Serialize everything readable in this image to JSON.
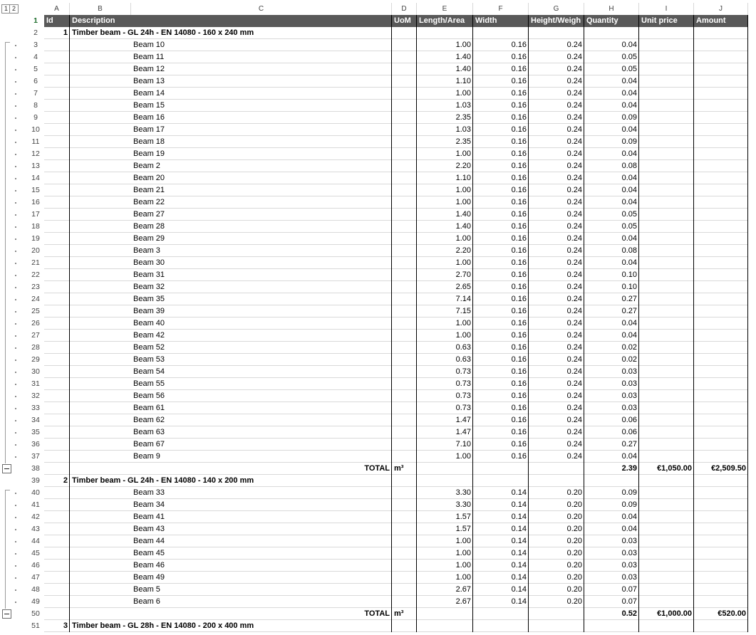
{
  "outline_levels": [
    "1",
    "2"
  ],
  "columns": [
    "A",
    "B",
    "C",
    "D",
    "E",
    "F",
    "G",
    "H",
    "I",
    "J"
  ],
  "header_row": {
    "row": "1",
    "cells": [
      "Id",
      "Description",
      "",
      "UoM",
      "Length/Area",
      "Width",
      "Height/Weigh",
      "Quantity",
      "Unit price",
      "Amount"
    ]
  },
  "rows": [
    {
      "row": "2",
      "cells": [
        "",
        "1",
        "Timber beam - GL 24h - EN 14080 - 160 x 240 mm",
        "",
        "",
        "",
        "",
        "",
        "",
        ""
      ],
      "kind": "group"
    },
    {
      "row": "3",
      "cells": [
        "",
        "",
        "Beam 10",
        "",
        "1.00",
        "0.16",
        "0.24",
        "0.04",
        "",
        ""
      ]
    },
    {
      "row": "4",
      "cells": [
        "",
        "",
        "Beam 11",
        "",
        "1.40",
        "0.16",
        "0.24",
        "0.05",
        "",
        ""
      ]
    },
    {
      "row": "5",
      "cells": [
        "",
        "",
        "Beam 12",
        "",
        "1.40",
        "0.16",
        "0.24",
        "0.05",
        "",
        ""
      ]
    },
    {
      "row": "6",
      "cells": [
        "",
        "",
        "Beam 13",
        "",
        "1.10",
        "0.16",
        "0.24",
        "0.04",
        "",
        ""
      ]
    },
    {
      "row": "7",
      "cells": [
        "",
        "",
        "Beam 14",
        "",
        "1.00",
        "0.16",
        "0.24",
        "0.04",
        "",
        ""
      ]
    },
    {
      "row": "8",
      "cells": [
        "",
        "",
        "Beam 15",
        "",
        "1.03",
        "0.16",
        "0.24",
        "0.04",
        "",
        ""
      ]
    },
    {
      "row": "9",
      "cells": [
        "",
        "",
        "Beam 16",
        "",
        "2.35",
        "0.16",
        "0.24",
        "0.09",
        "",
        ""
      ]
    },
    {
      "row": "10",
      "cells": [
        "",
        "",
        "Beam 17",
        "",
        "1.03",
        "0.16",
        "0.24",
        "0.04",
        "",
        ""
      ]
    },
    {
      "row": "11",
      "cells": [
        "",
        "",
        "Beam 18",
        "",
        "2.35",
        "0.16",
        "0.24",
        "0.09",
        "",
        ""
      ]
    },
    {
      "row": "12",
      "cells": [
        "",
        "",
        "Beam 19",
        "",
        "1.00",
        "0.16",
        "0.24",
        "0.04",
        "",
        ""
      ]
    },
    {
      "row": "13",
      "cells": [
        "",
        "",
        "Beam 2",
        "",
        "2.20",
        "0.16",
        "0.24",
        "0.08",
        "",
        ""
      ]
    },
    {
      "row": "14",
      "cells": [
        "",
        "",
        "Beam 20",
        "",
        "1.10",
        "0.16",
        "0.24",
        "0.04",
        "",
        ""
      ]
    },
    {
      "row": "15",
      "cells": [
        "",
        "",
        "Beam 21",
        "",
        "1.00",
        "0.16",
        "0.24",
        "0.04",
        "",
        ""
      ]
    },
    {
      "row": "16",
      "cells": [
        "",
        "",
        "Beam 22",
        "",
        "1.00",
        "0.16",
        "0.24",
        "0.04",
        "",
        ""
      ]
    },
    {
      "row": "17",
      "cells": [
        "",
        "",
        "Beam 27",
        "",
        "1.40",
        "0.16",
        "0.24",
        "0.05",
        "",
        ""
      ]
    },
    {
      "row": "18",
      "cells": [
        "",
        "",
        "Beam 28",
        "",
        "1.40",
        "0.16",
        "0.24",
        "0.05",
        "",
        ""
      ]
    },
    {
      "row": "19",
      "cells": [
        "",
        "",
        "Beam 29",
        "",
        "1.00",
        "0.16",
        "0.24",
        "0.04",
        "",
        ""
      ]
    },
    {
      "row": "20",
      "cells": [
        "",
        "",
        "Beam 3",
        "",
        "2.20",
        "0.16",
        "0.24",
        "0.08",
        "",
        ""
      ]
    },
    {
      "row": "21",
      "cells": [
        "",
        "",
        "Beam 30",
        "",
        "1.00",
        "0.16",
        "0.24",
        "0.04",
        "",
        ""
      ]
    },
    {
      "row": "22",
      "cells": [
        "",
        "",
        "Beam 31",
        "",
        "2.70",
        "0.16",
        "0.24",
        "0.10",
        "",
        ""
      ]
    },
    {
      "row": "23",
      "cells": [
        "",
        "",
        "Beam 32",
        "",
        "2.65",
        "0.16",
        "0.24",
        "0.10",
        "",
        ""
      ]
    },
    {
      "row": "24",
      "cells": [
        "",
        "",
        "Beam 35",
        "",
        "7.14",
        "0.16",
        "0.24",
        "0.27",
        "",
        ""
      ]
    },
    {
      "row": "25",
      "cells": [
        "",
        "",
        "Beam 39",
        "",
        "7.15",
        "0.16",
        "0.24",
        "0.27",
        "",
        ""
      ]
    },
    {
      "row": "26",
      "cells": [
        "",
        "",
        "Beam 40",
        "",
        "1.00",
        "0.16",
        "0.24",
        "0.04",
        "",
        ""
      ]
    },
    {
      "row": "27",
      "cells": [
        "",
        "",
        "Beam 42",
        "",
        "1.00",
        "0.16",
        "0.24",
        "0.04",
        "",
        ""
      ]
    },
    {
      "row": "28",
      "cells": [
        "",
        "",
        "Beam 52",
        "",
        "0.63",
        "0.16",
        "0.24",
        "0.02",
        "",
        ""
      ]
    },
    {
      "row": "29",
      "cells": [
        "",
        "",
        "Beam 53",
        "",
        "0.63",
        "0.16",
        "0.24",
        "0.02",
        "",
        ""
      ]
    },
    {
      "row": "30",
      "cells": [
        "",
        "",
        "Beam 54",
        "",
        "0.73",
        "0.16",
        "0.24",
        "0.03",
        "",
        ""
      ]
    },
    {
      "row": "31",
      "cells": [
        "",
        "",
        "Beam 55",
        "",
        "0.73",
        "0.16",
        "0.24",
        "0.03",
        "",
        ""
      ]
    },
    {
      "row": "32",
      "cells": [
        "",
        "",
        "Beam 56",
        "",
        "0.73",
        "0.16",
        "0.24",
        "0.03",
        "",
        ""
      ]
    },
    {
      "row": "33",
      "cells": [
        "",
        "",
        "Beam 61",
        "",
        "0.73",
        "0.16",
        "0.24",
        "0.03",
        "",
        ""
      ]
    },
    {
      "row": "34",
      "cells": [
        "",
        "",
        "Beam 62",
        "",
        "1.47",
        "0.16",
        "0.24",
        "0.06",
        "",
        ""
      ]
    },
    {
      "row": "35",
      "cells": [
        "",
        "",
        "Beam 63",
        "",
        "1.47",
        "0.16",
        "0.24",
        "0.06",
        "",
        ""
      ]
    },
    {
      "row": "36",
      "cells": [
        "",
        "",
        "Beam 67",
        "",
        "7.10",
        "0.16",
        "0.24",
        "0.27",
        "",
        ""
      ]
    },
    {
      "row": "37",
      "cells": [
        "",
        "",
        "Beam 9",
        "",
        "1.00",
        "0.16",
        "0.24",
        "0.04",
        "",
        ""
      ]
    },
    {
      "row": "38",
      "cells": [
        "",
        "",
        "TOTAL",
        "m³",
        "",
        "",
        "",
        "2.39",
        "€1,050.00",
        "€2,509.50"
      ],
      "kind": "total"
    },
    {
      "row": "39",
      "cells": [
        "",
        "2",
        "Timber beam - GL 24h - EN 14080 - 140 x 200 mm",
        "",
        "",
        "",
        "",
        "",
        "",
        ""
      ],
      "kind": "group"
    },
    {
      "row": "40",
      "cells": [
        "",
        "",
        "Beam 33",
        "",
        "3.30",
        "0.14",
        "0.20",
        "0.09",
        "",
        ""
      ]
    },
    {
      "row": "41",
      "cells": [
        "",
        "",
        "Beam 34",
        "",
        "3.30",
        "0.14",
        "0.20",
        "0.09",
        "",
        ""
      ]
    },
    {
      "row": "42",
      "cells": [
        "",
        "",
        "Beam 41",
        "",
        "1.57",
        "0.14",
        "0.20",
        "0.04",
        "",
        ""
      ]
    },
    {
      "row": "43",
      "cells": [
        "",
        "",
        "Beam 43",
        "",
        "1.57",
        "0.14",
        "0.20",
        "0.04",
        "",
        ""
      ]
    },
    {
      "row": "44",
      "cells": [
        "",
        "",
        "Beam 44",
        "",
        "1.00",
        "0.14",
        "0.20",
        "0.03",
        "",
        ""
      ]
    },
    {
      "row": "45",
      "cells": [
        "",
        "",
        "Beam 45",
        "",
        "1.00",
        "0.14",
        "0.20",
        "0.03",
        "",
        ""
      ]
    },
    {
      "row": "46",
      "cells": [
        "",
        "",
        "Beam 46",
        "",
        "1.00",
        "0.14",
        "0.20",
        "0.03",
        "",
        ""
      ]
    },
    {
      "row": "47",
      "cells": [
        "",
        "",
        "Beam 49",
        "",
        "1.00",
        "0.14",
        "0.20",
        "0.03",
        "",
        ""
      ]
    },
    {
      "row": "48",
      "cells": [
        "",
        "",
        "Beam 5",
        "",
        "2.67",
        "0.14",
        "0.20",
        "0.07",
        "",
        ""
      ]
    },
    {
      "row": "49",
      "cells": [
        "",
        "",
        "Beam 6",
        "",
        "2.67",
        "0.14",
        "0.20",
        "0.07",
        "",
        ""
      ]
    },
    {
      "row": "50",
      "cells": [
        "",
        "",
        "TOTAL",
        "m³",
        "",
        "",
        "",
        "0.52",
        "€1,000.00",
        "€520.00"
      ],
      "kind": "total"
    },
    {
      "row": "51",
      "cells": [
        "",
        "3",
        "Timber beam - GL 28h - EN 14080 - 200 x 400 mm",
        "",
        "",
        "",
        "",
        "",
        "",
        ""
      ],
      "kind": "group"
    }
  ],
  "colors": {
    "header_bg": "#595959",
    "selected_row_number": "#1f6e2d"
  }
}
